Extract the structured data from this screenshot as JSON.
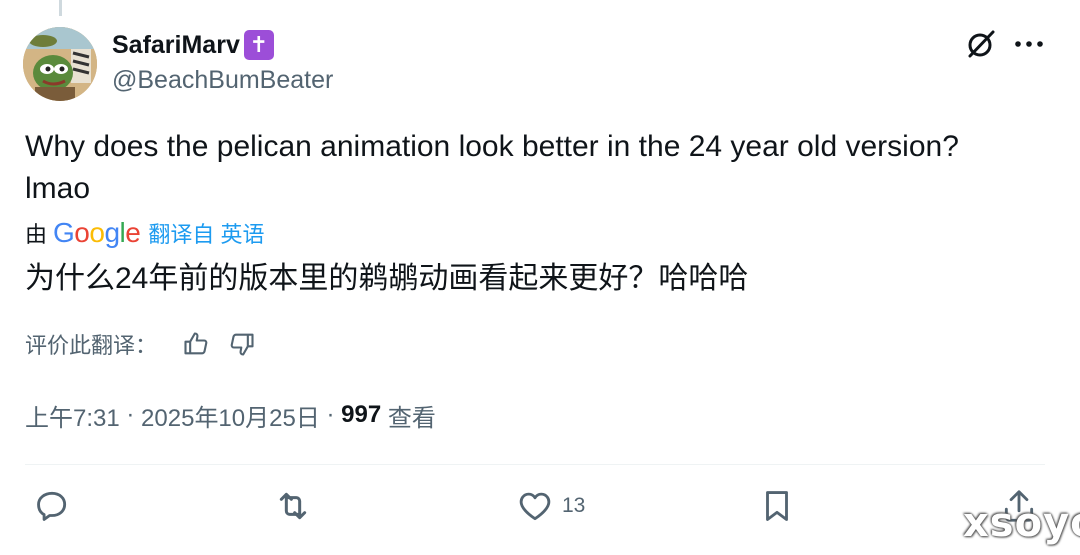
{
  "author": {
    "display_name": "SafariMarv",
    "badge": "✝",
    "handle": "@BeachBumBeater"
  },
  "tweet": {
    "text_line1": "Why does the pelican animation look better in the 24 year old version?",
    "text_line2": "lmao"
  },
  "translation": {
    "prefix": "由",
    "provider_letters": [
      "G",
      "o",
      "o",
      "g",
      "l",
      "e"
    ],
    "provider_colors": [
      "#4285f4",
      "#ea4335",
      "#fbbc05",
      "#4285f4",
      "#34a853",
      "#ea4335"
    ],
    "link_label": "翻译自 英语",
    "translated_text": "为什么24年前的版本里的鹈鹕动画看起来更好？哈哈哈",
    "rate_label": "评价此翻译："
  },
  "meta": {
    "time": "上午7:31",
    "separator": " · ",
    "date": "2025年10月25日",
    "views_count": "997",
    "views_label": " 查看"
  },
  "actions": {
    "like_count": "13"
  },
  "watermark": "xsoyo",
  "icons": {
    "grok": "grok-icon",
    "more": "more-icon",
    "thumbs_up": "thumbs-up-icon",
    "thumbs_down": "thumbs-down-icon",
    "reply": "reply-icon",
    "retweet": "retweet-icon",
    "like": "heart-icon",
    "bookmark": "bookmark-icon",
    "share": "share-icon"
  },
  "colors": {
    "badge": "#9c4ed8",
    "link": "#1d9bf0",
    "secondary_text": "#536471",
    "primary_text": "#0f1419"
  }
}
